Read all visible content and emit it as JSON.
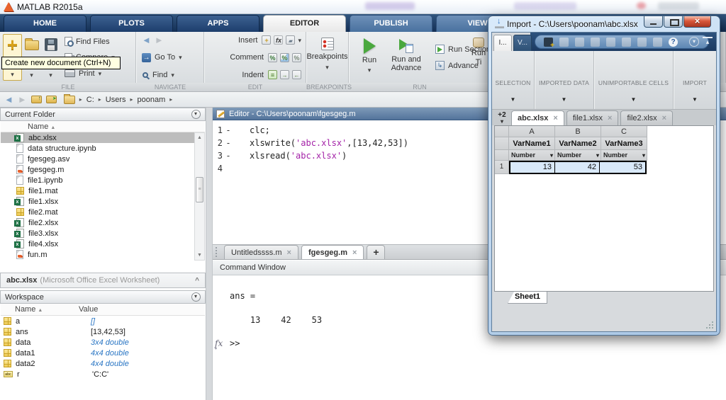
{
  "titlebar": {
    "title": "MATLAB R2015a"
  },
  "ribbon_tabs": [
    {
      "label": "HOME"
    },
    {
      "label": "PLOTS"
    },
    {
      "label": "APPS"
    },
    {
      "label": "EDITOR"
    },
    {
      "label": "PUBLISH"
    },
    {
      "label": "VIEW"
    }
  ],
  "ribbon": {
    "file": {
      "label": "FILE",
      "find_files": "Find Files",
      "compare": "Compare",
      "print": "Print"
    },
    "navigate": {
      "label": "NAVIGATE",
      "go_to": "Go To",
      "find": "Find"
    },
    "edit": {
      "label": "EDIT",
      "insert": "Insert",
      "comment": "Comment",
      "indent": "Indent"
    },
    "breakpoints": {
      "label": "BREAKPOINTS",
      "button": "Breakpoints"
    },
    "run": {
      "label": "RUN",
      "run": "Run",
      "run_and_advance": "Run and Advance",
      "run_section": "Run Section",
      "advance": "Advance",
      "run_time": "Run Ti"
    }
  },
  "tooltip": {
    "text": "Create new document (Ctrl+N)"
  },
  "breadcrumb": {
    "items": [
      "C:",
      "Users",
      "poonam"
    ]
  },
  "current_folder": {
    "title": "Current Folder",
    "name_header": "Name",
    "files": [
      {
        "name": "abc.xlsx",
        "icon": "ic-excel"
      },
      {
        "name": "data structure.ipynb",
        "icon": "ic-page"
      },
      {
        "name": "fgesgeg.asv",
        "icon": "ic-page"
      },
      {
        "name": "fgesgeg.m",
        "icon": "ic-mfile"
      },
      {
        "name": "file1.ipynb",
        "icon": "ic-page"
      },
      {
        "name": "file1.mat",
        "icon": "ic-mat"
      },
      {
        "name": "file1.xlsx",
        "icon": "ic-excel"
      },
      {
        "name": "file2.mat",
        "icon": "ic-mat"
      },
      {
        "name": "file2.xlsx",
        "icon": "ic-excel"
      },
      {
        "name": "file3.xlsx",
        "icon": "ic-excel"
      },
      {
        "name": "file4.xlsx",
        "icon": "ic-excel"
      },
      {
        "name": "fun.m",
        "icon": "ic-mfile"
      }
    ],
    "status_file": "abc.xlsx",
    "status_info": "(Microsoft Office Excel Worksheet)"
  },
  "workspace": {
    "title": "Workspace",
    "name_header": "Name",
    "value_header": "Value",
    "rows": [
      {
        "name": "a",
        "value": "[]",
        "cls": "val-blue",
        "icon": "ic-mat"
      },
      {
        "name": "ans",
        "value": "[13,42,53]",
        "cls": "",
        "icon": "ic-mat"
      },
      {
        "name": "data",
        "value": "3x4 double",
        "cls": "val-blue",
        "icon": "ic-mat"
      },
      {
        "name": "data1",
        "value": "4x4 double",
        "cls": "val-blue",
        "icon": "ic-mat"
      },
      {
        "name": "data2",
        "value": "4x4 double",
        "cls": "val-blue",
        "icon": "ic-mat"
      },
      {
        "name": "r",
        "value": "'C:C'",
        "cls": "",
        "icon": "ic-abc"
      }
    ]
  },
  "editor": {
    "title": "Editor - C:\\Users\\poonam\\fgesgeg.m",
    "lines": [
      {
        "n": "1",
        "m": "-",
        "a": "clc;",
        "s": "",
        "b": ""
      },
      {
        "n": "2",
        "m": "-",
        "a": "xlswrite(",
        "s": "'abc.xlsx'",
        "b": ",[13,42,53])"
      },
      {
        "n": "3",
        "m": "-",
        "a": "xlsread(",
        "s": "'abc.xlsx'",
        "b": ")"
      },
      {
        "n": "4",
        "m": "",
        "a": "",
        "s": "",
        "b": ""
      }
    ],
    "tabs": [
      {
        "label": "Untitledssss.m"
      },
      {
        "label": "fgesgeg.m"
      }
    ],
    "new_tab": "+"
  },
  "command_window": {
    "title": "Command Window",
    "output_1": "ans =",
    "output_2": "    13    42    53",
    "prompt": ">>"
  },
  "import_dialog": {
    "title": "Import - C:\\Users\\poonam\\abc.xlsx",
    "mini_tabs": [
      "I...",
      "V..."
    ],
    "sections": [
      "SELECTION",
      "IMPORTED DATA",
      "UNIMPORTABLE CELLS",
      "IMPORT"
    ],
    "new_tabs_button": "+2",
    "doc_tabs": [
      {
        "label": "abc.xlsx"
      },
      {
        "label": "file1.xlsx"
      },
      {
        "label": "file2.xlsx"
      }
    ],
    "columns": [
      {
        "letter": "A",
        "varname": "VarName1",
        "type": "Number"
      },
      {
        "letter": "B",
        "varname": "VarName2",
        "type": "Number"
      },
      {
        "letter": "C",
        "varname": "VarName3",
        "type": "Number"
      }
    ],
    "data_row": {
      "num": "1",
      "values": [
        "13",
        "42",
        "53"
      ]
    },
    "sheet_tab": "Sheet1"
  }
}
